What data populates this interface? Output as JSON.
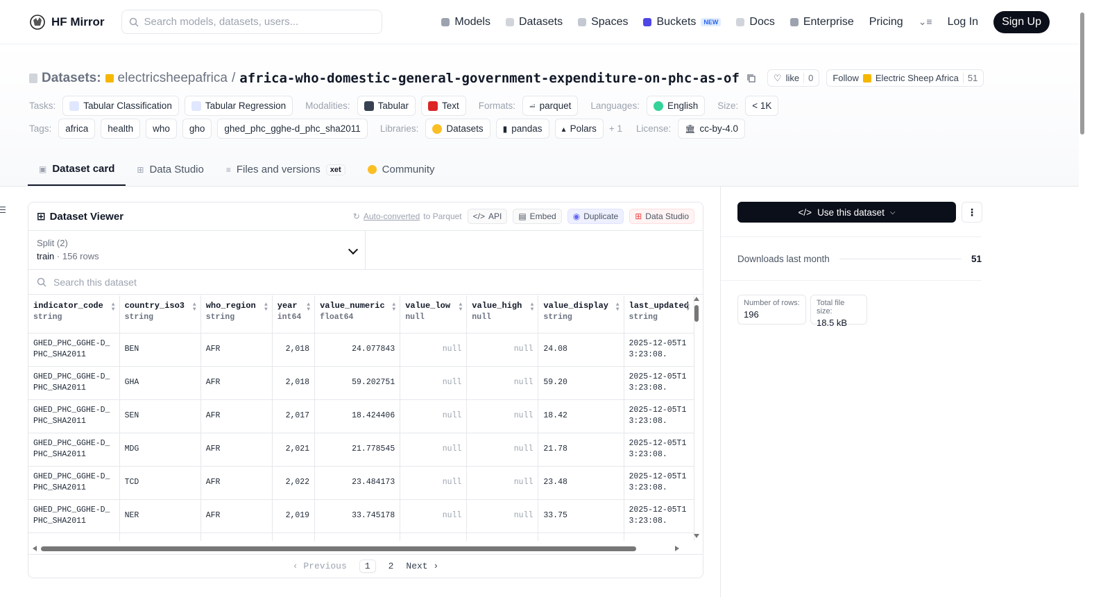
{
  "nav": {
    "brand": "HF Mirror",
    "search_placeholder": "Search models, datasets, users...",
    "links": {
      "models": "Models",
      "datasets": "Datasets",
      "spaces": "Spaces",
      "buckets": "Buckets",
      "buckets_badge": "NEW",
      "docs": "Docs",
      "enterprise": "Enterprise",
      "pricing": "Pricing"
    },
    "login": "Log In",
    "signup": "Sign Up"
  },
  "header": {
    "section": "Datasets:",
    "org": "electricsheepafrica",
    "separator": "/",
    "repo": "africa-who-domestic-general-government-expenditure-on-phc-as-of",
    "like_label": "like",
    "like_count": "0",
    "follow_label": "Follow",
    "follow_org": "Electric Sheep Africa",
    "follow_count": "51"
  },
  "meta": {
    "tasks_label": "Tasks:",
    "tasks": [
      "Tabular Classification",
      "Tabular Regression"
    ],
    "modalities_label": "Modalities:",
    "modalities": [
      "Tabular",
      "Text"
    ],
    "formats_label": "Formats:",
    "format": "parquet",
    "languages_label": "Languages:",
    "language": "English",
    "size_label": "Size:",
    "size": "< 1K",
    "tags_label": "Tags:",
    "tags": [
      "africa",
      "health",
      "who",
      "gho",
      "ghed_phc_gghe-d_phc_sha2011"
    ],
    "libraries_label": "Libraries:",
    "libraries": [
      "Datasets",
      "pandas",
      "Polars"
    ],
    "libraries_more": "+ 1",
    "license_label": "License:",
    "license": "cc-by-4.0"
  },
  "tabs": {
    "card": "Dataset card",
    "studio": "Data Studio",
    "files": "Files and versions",
    "files_badge": "xet",
    "community": "Community"
  },
  "viewer": {
    "title": "Dataset Viewer",
    "autoconv_link": "Auto-converted",
    "autoconv_rest": "to Parquet",
    "api": "API",
    "embed": "Embed",
    "duplicate": "Duplicate",
    "data_studio": "Data Studio",
    "split_label": "Split (2)",
    "split_name": "train",
    "split_rows": "156 rows",
    "search_placeholder": "Search this dataset",
    "columns": [
      {
        "name": "indicator_code",
        "type": "string"
      },
      {
        "name": "country_iso3",
        "type": "string"
      },
      {
        "name": "who_region",
        "type": "string"
      },
      {
        "name": "year",
        "type": "int64"
      },
      {
        "name": "value_numeric",
        "type": "float64"
      },
      {
        "name": "value_low",
        "type": "null"
      },
      {
        "name": "value_high",
        "type": "null"
      },
      {
        "name": "value_display",
        "type": "string"
      },
      {
        "name": "last_updated",
        "type": "string"
      }
    ],
    "rows": [
      [
        "GHED_PHC_GGHE-D_PHC_SHA2011",
        "BEN",
        "AFR",
        "2,018",
        "24.077843",
        "null",
        "null",
        "24.08",
        "2025-12-05T13:23:08."
      ],
      [
        "GHED_PHC_GGHE-D_PHC_SHA2011",
        "GHA",
        "AFR",
        "2,018",
        "59.202751",
        "null",
        "null",
        "59.20",
        "2025-12-05T13:23:08."
      ],
      [
        "GHED_PHC_GGHE-D_PHC_SHA2011",
        "SEN",
        "AFR",
        "2,017",
        "18.424406",
        "null",
        "null",
        "18.42",
        "2025-12-05T13:23:08."
      ],
      [
        "GHED_PHC_GGHE-D_PHC_SHA2011",
        "MDG",
        "AFR",
        "2,021",
        "21.778545",
        "null",
        "null",
        "21.78",
        "2025-12-05T13:23:08."
      ],
      [
        "GHED_PHC_GGHE-D_PHC_SHA2011",
        "TCD",
        "AFR",
        "2,022",
        "23.484173",
        "null",
        "null",
        "23.48",
        "2025-12-05T13:23:08."
      ],
      [
        "GHED_PHC_GGHE-D_PHC_SHA2011",
        "NER",
        "AFR",
        "2,019",
        "33.745178",
        "null",
        "null",
        "33.75",
        "2025-12-05T13:23:08."
      ],
      [
        "GHED_PHC_GGHE-",
        "",
        "",
        "",
        "",
        "",
        "",
        "",
        "2025-12-"
      ]
    ],
    "pager": {
      "prev": "Previous",
      "pages": [
        "1",
        "2"
      ],
      "next": "Next"
    }
  },
  "sidebar": {
    "use_button": "Use this dataset",
    "downloads_label": "Downloads last month",
    "downloads_value": "51",
    "rows_label": "Number of rows:",
    "rows_value": "196",
    "size_label": "Total file size:",
    "size_value": "18.5 kB"
  }
}
